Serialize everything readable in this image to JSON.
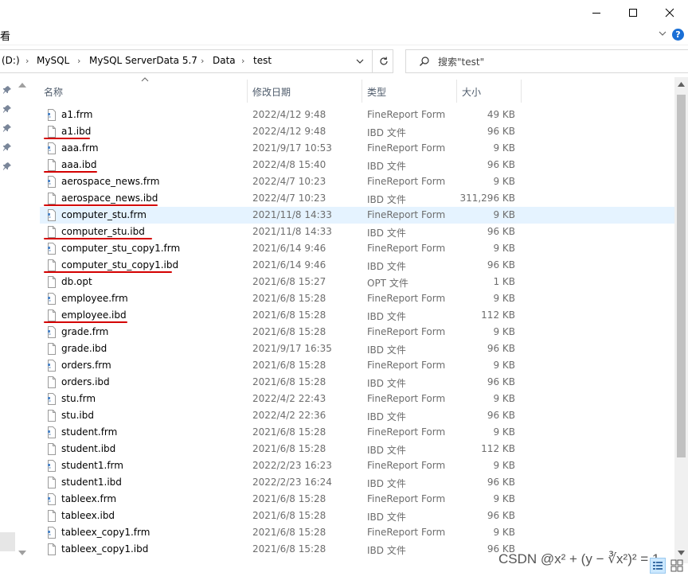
{
  "window": {
    "minimize_icon": "minimize-icon",
    "maximize_icon": "maximize-icon",
    "close_icon": "close-icon"
  },
  "ribbon": {
    "view_label": "看",
    "help_label": "?"
  },
  "address": {
    "crumbs": [
      "(D:)",
      "MySQL",
      "MySQL ServerData 5.7",
      "Data",
      "test"
    ]
  },
  "search": {
    "placeholder": "搜索\"test\""
  },
  "columns": {
    "name": "名称",
    "date": "修改日期",
    "type": "类型",
    "size": "大小"
  },
  "files": [
    {
      "name": "a1.frm",
      "date": "2022/4/12 9:48",
      "type": "FineReport Form",
      "size": "49 KB",
      "icon": "frm",
      "underline": false
    },
    {
      "name": "a1.ibd",
      "date": "2022/4/12 9:48",
      "type": "IBD 文件",
      "size": "96 KB",
      "icon": "file",
      "underline": true
    },
    {
      "name": "aaa.frm",
      "date": "2021/9/17 10:53",
      "type": "FineReport Form",
      "size": "9 KB",
      "icon": "frm",
      "underline": false
    },
    {
      "name": "aaa.ibd",
      "date": "2022/4/8 15:40",
      "type": "IBD 文件",
      "size": "96 KB",
      "icon": "file",
      "underline": true
    },
    {
      "name": "aerospace_news.frm",
      "date": "2022/4/7 10:23",
      "type": "FineReport Form",
      "size": "9 KB",
      "icon": "frm",
      "underline": false
    },
    {
      "name": "aerospace_news.ibd",
      "date": "2022/4/7 10:23",
      "type": "IBD 文件",
      "size": "311,296 KB",
      "icon": "file",
      "underline": true
    },
    {
      "name": "computer_stu.frm",
      "date": "2021/11/8 14:33",
      "type": "FineReport Form",
      "size": "9 KB",
      "icon": "frm",
      "underline": false,
      "selected": true
    },
    {
      "name": "computer_stu.ibd",
      "date": "2021/11/8 14:33",
      "type": "IBD 文件",
      "size": "96 KB",
      "icon": "file",
      "underline": true
    },
    {
      "name": "computer_stu_copy1.frm",
      "date": "2021/6/14 9:46",
      "type": "FineReport Form",
      "size": "9 KB",
      "icon": "frm",
      "underline": false
    },
    {
      "name": "computer_stu_copy1.ibd",
      "date": "2021/6/14 9:46",
      "type": "IBD 文件",
      "size": "96 KB",
      "icon": "file",
      "underline": true
    },
    {
      "name": "db.opt",
      "date": "2021/6/8 15:27",
      "type": "OPT 文件",
      "size": "1 KB",
      "icon": "file",
      "underline": false
    },
    {
      "name": "employee.frm",
      "date": "2021/6/8 15:28",
      "type": "FineReport Form",
      "size": "9 KB",
      "icon": "frm",
      "underline": false
    },
    {
      "name": "employee.ibd",
      "date": "2021/6/8 15:28",
      "type": "IBD 文件",
      "size": "112 KB",
      "icon": "file",
      "underline": true
    },
    {
      "name": "grade.frm",
      "date": "2021/6/8 15:28",
      "type": "FineReport Form",
      "size": "9 KB",
      "icon": "frm",
      "underline": false
    },
    {
      "name": "grade.ibd",
      "date": "2021/9/17 16:35",
      "type": "IBD 文件",
      "size": "96 KB",
      "icon": "file",
      "underline": false
    },
    {
      "name": "orders.frm",
      "date": "2021/6/8 15:28",
      "type": "FineReport Form",
      "size": "9 KB",
      "icon": "frm",
      "underline": false
    },
    {
      "name": "orders.ibd",
      "date": "2021/6/8 15:28",
      "type": "IBD 文件",
      "size": "96 KB",
      "icon": "file",
      "underline": false
    },
    {
      "name": "stu.frm",
      "date": "2022/4/2 22:43",
      "type": "FineReport Form",
      "size": "9 KB",
      "icon": "frm",
      "underline": false
    },
    {
      "name": "stu.ibd",
      "date": "2022/4/2 22:36",
      "type": "IBD 文件",
      "size": "96 KB",
      "icon": "file",
      "underline": false
    },
    {
      "name": "student.frm",
      "date": "2021/6/8 15:28",
      "type": "FineReport Form",
      "size": "9 KB",
      "icon": "frm",
      "underline": false
    },
    {
      "name": "student.ibd",
      "date": "2021/6/8 15:28",
      "type": "IBD 文件",
      "size": "112 KB",
      "icon": "file",
      "underline": false
    },
    {
      "name": "student1.frm",
      "date": "2022/2/23 16:23",
      "type": "FineReport Form",
      "size": "9 KB",
      "icon": "frm",
      "underline": false
    },
    {
      "name": "student1.ibd",
      "date": "2022/2/23 16:24",
      "type": "IBD 文件",
      "size": "96 KB",
      "icon": "file",
      "underline": false
    },
    {
      "name": "tableex.frm",
      "date": "2021/6/8 15:28",
      "type": "FineReport Form",
      "size": "9 KB",
      "icon": "frm",
      "underline": false
    },
    {
      "name": "tableex.ibd",
      "date": "2021/6/8 15:28",
      "type": "IBD 文件",
      "size": "96 KB",
      "icon": "file",
      "underline": false
    },
    {
      "name": "tableex_copy1.frm",
      "date": "2021/6/8 15:28",
      "type": "FineReport Form",
      "size": "9 KB",
      "icon": "frm",
      "underline": false
    },
    {
      "name": "tableex_copy1.ibd",
      "date": "2021/6/8 15:28",
      "type": "IBD 文件",
      "size": "96 KB",
      "icon": "file",
      "underline": false
    }
  ],
  "watermark": "CSDN @x² + (y − ∛x²)² = 1",
  "colors": {
    "selection": "#e5f3ff",
    "annotation": "#d40000",
    "accent": "#1a6fd6"
  }
}
